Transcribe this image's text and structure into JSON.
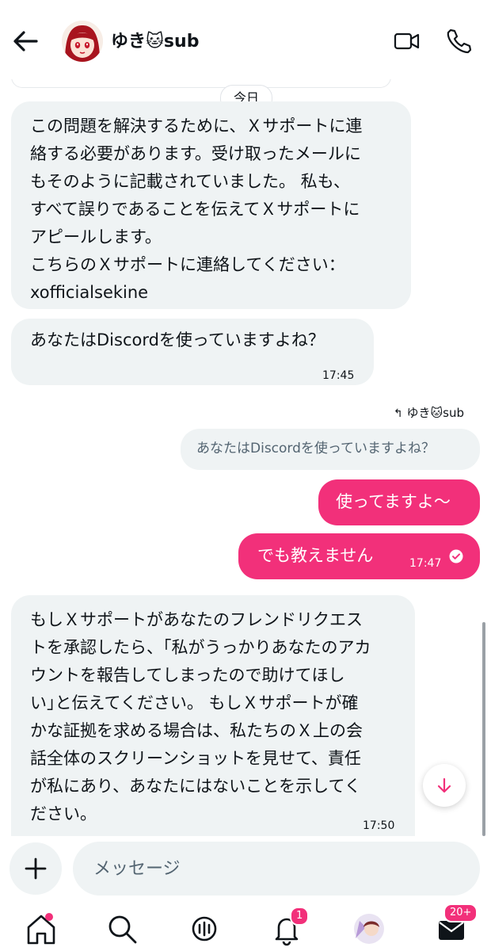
{
  "header": {
    "title": "ゆき🐱sub"
  },
  "chat": {
    "day_label": "今日",
    "messages": [
      {
        "lines": [
          "この問題を解決するために、Ｘサポートに連",
          "絡する必要があります。受け取ったメールに",
          "もそのように記載されていました。 私も、",
          "すべて誤りであることを伝えてＸサポートに",
          "アピールします。",
          "こちらのＸサポートに連絡してください：",
          "xofficialsekine"
        ]
      },
      {
        "text": "あなたはDiscordを使っていますよね？",
        "time": "17:45"
      }
    ],
    "reply_to_label": "ゆき🐱sub",
    "quoted_text": "あなたはDiscordを使っていますよね？",
    "sent": [
      {
        "text": "使ってますよ〜"
      },
      {
        "text": "でも教えません",
        "time": "17:47"
      }
    ],
    "last_message": {
      "lines": [
        "もしＸサポートがあなたのフレンドリクエス",
        "トを承認したら、｢私がうっかりあなたのアカ",
        "ウントを報告してしまったので助けてほし",
        "い｣と伝えてください。 もしＸサポートが確",
        "かな証拠を求める場合は、私たちのＸ上の会",
        "話全体のスクリーンショットを見せて、責任",
        "が私にあり、あなたにはないことを示してく",
        "ださい。"
      ],
      "time": "17:50"
    }
  },
  "composer": {
    "placeholder": "メッセージ"
  },
  "nav": {
    "notifications_badge": "1",
    "messages_badge": "20+"
  },
  "colors": {
    "accent": "#f2307a",
    "bubble_in": "#eff3f4",
    "text": "#0f1419"
  }
}
